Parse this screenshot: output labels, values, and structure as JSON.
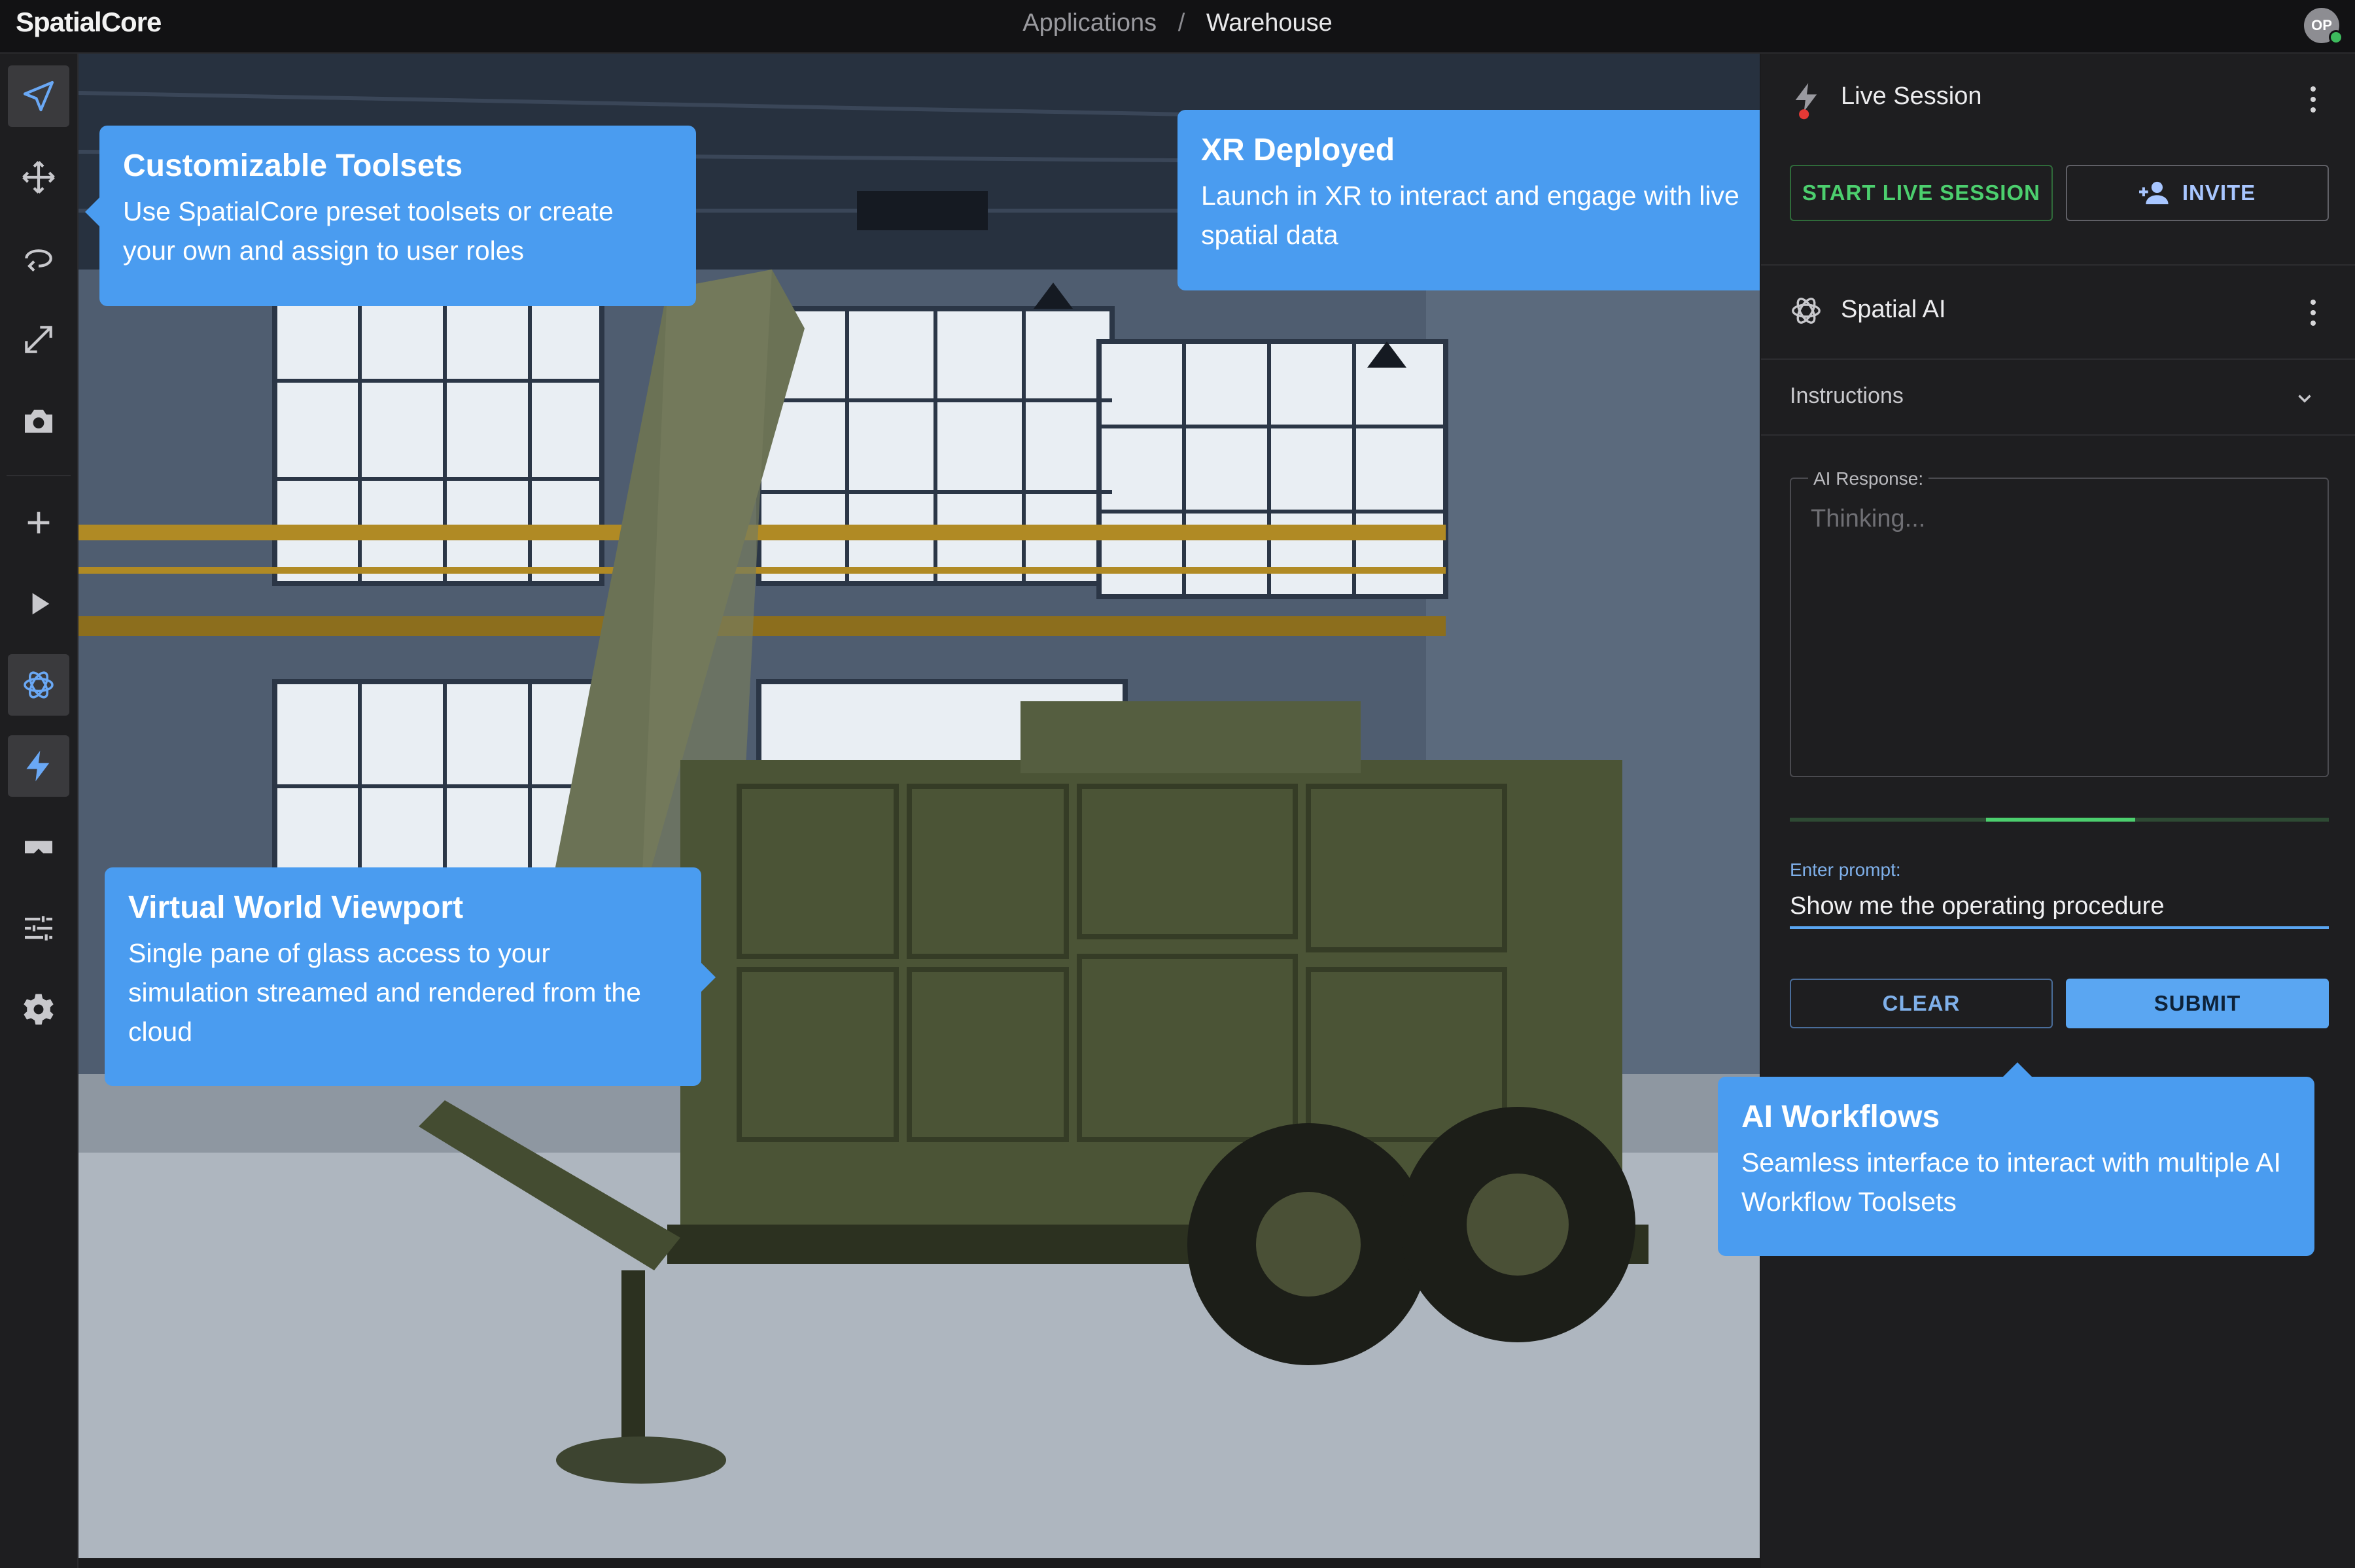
{
  "app": {
    "brand": "SpatialCore",
    "avatar_initials": "OP"
  },
  "breadcrumb": {
    "parent": "Applications",
    "separator": "/",
    "current": "Warehouse"
  },
  "toolbar": {
    "tools": [
      "navigate-icon",
      "move-icon",
      "rotate-icon",
      "scale-icon",
      "camera-icon",
      "add-icon",
      "play-icon",
      "ai-icon",
      "live-icon",
      "vr-headset-icon",
      "sliders-icon",
      "settings-icon"
    ],
    "active": [
      "navigate-icon",
      "ai-icon",
      "live-icon"
    ]
  },
  "callouts": {
    "toolsets": {
      "title": "Customizable Toolsets",
      "body": "Use SpatialCore preset toolsets or create your own and assign to user roles"
    },
    "xr": {
      "title": "XR Deployed",
      "body": "Launch in XR to interact and engage with live spatial data"
    },
    "viewport": {
      "title": "Virtual World Viewport",
      "body": "Single pane of glass access to your simulation streamed and rendered from the cloud"
    },
    "ai": {
      "title": "AI Workflows",
      "body": "Seamless interface to interact with multiple AI Workflow Toolsets"
    }
  },
  "live_session": {
    "title": "Live Session",
    "start_label": "START LIVE SESSION",
    "invite_label": "INVITE"
  },
  "spatial_ai": {
    "title": "Spatial AI",
    "instructions_label": "Instructions",
    "response_label": "AI Response:",
    "response_placeholder": "Thinking...",
    "prompt_label": "Enter prompt:",
    "prompt_value": "Show me the operating procedure",
    "clear_label": "CLEAR",
    "submit_label": "SUBMIT"
  },
  "colors": {
    "accent_blue": "#4a9cf0",
    "live_green": "#4ccf6e",
    "record_red": "#e53935"
  }
}
